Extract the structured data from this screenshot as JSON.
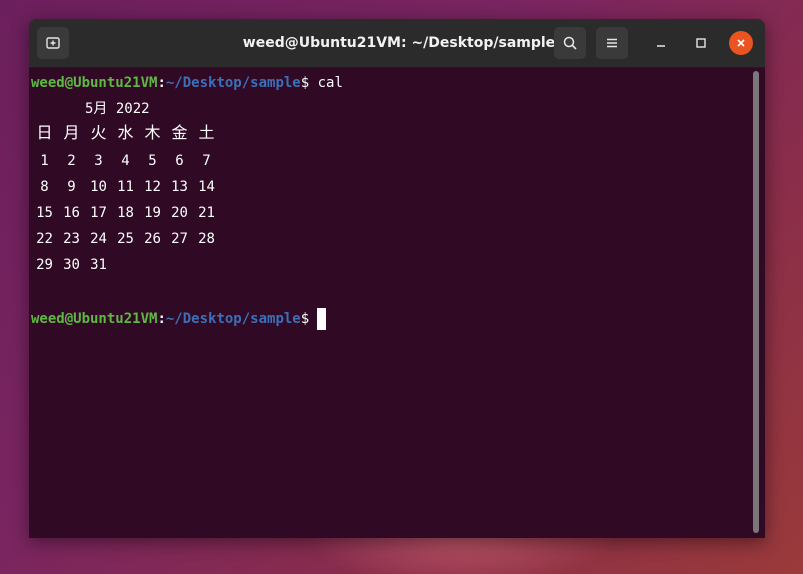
{
  "window": {
    "title": "weed@Ubuntu21VM: ~/Desktop/sample"
  },
  "titlebar": {
    "new_tab_icon": "new-tab-icon",
    "search_icon": "search-icon",
    "menu_icon": "hamburger-menu-icon",
    "minimize_icon": "minimize-icon",
    "maximize_icon": "maximize-icon",
    "close_icon": "close-icon"
  },
  "colors": {
    "prompt_user": "#5fb843",
    "prompt_path": "#3d6fb8",
    "terminal_bg": "#300a24",
    "close_button": "#e95420"
  },
  "terminal": {
    "prompt1": {
      "user_host": "weed@Ubuntu21VM",
      "colon": ":",
      "path": "~/Desktop/sample",
      "dollar": "$",
      "command": " cal"
    },
    "calendar": {
      "header": "5月 2022",
      "weekdays": [
        "日",
        "月",
        "火",
        "水",
        "木",
        "金",
        "土"
      ],
      "weeks": [
        [
          "1",
          "2",
          "3",
          "4",
          "5",
          "6",
          "7"
        ],
        [
          "8",
          "9",
          "10",
          "11",
          "12",
          "13",
          "14"
        ],
        [
          "15",
          "16",
          "17",
          "18",
          "19",
          "20",
          "21"
        ],
        [
          "22",
          "23",
          "24",
          "25",
          "26",
          "27",
          "28"
        ],
        [
          "29",
          "30",
          "31",
          "",
          "",
          "",
          ""
        ]
      ]
    },
    "prompt2": {
      "user_host": "weed@Ubuntu21VM",
      "colon": ":",
      "path": "~/Desktop/sample",
      "dollar": "$"
    }
  }
}
